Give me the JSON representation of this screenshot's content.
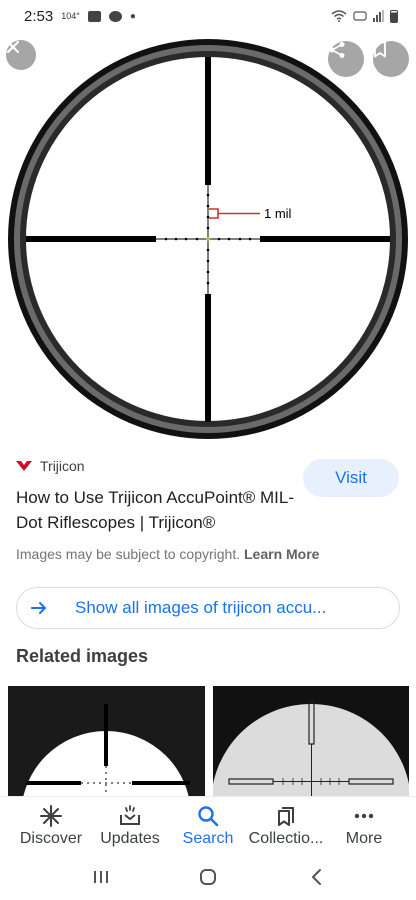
{
  "status_bar": {
    "time": "2:53",
    "temperature": "104°"
  },
  "viewer": {
    "image_annotation": "1 mil",
    "icons": {
      "close": "close-icon",
      "share": "share-icon",
      "save": "bookmark-icon"
    }
  },
  "result": {
    "source_name": "Trijicon",
    "visit_label": "Visit",
    "title": "How to Use Trijicon AccuPoint® MIL-Dot Riflescopes | Trijicon®",
    "copyright_text": "Images may be subject to copyright.",
    "learn_more": "Learn More"
  },
  "show_all": {
    "label": "Show all images of trijicon accu..."
  },
  "related": {
    "heading": "Related images"
  },
  "bottom_nav": {
    "items": [
      {
        "label": "Discover",
        "icon": "asterisk-icon"
      },
      {
        "label": "Updates",
        "icon": "updates-icon"
      },
      {
        "label": "Search",
        "icon": "search-icon"
      },
      {
        "label": "Collectio...",
        "icon": "collections-icon"
      },
      {
        "label": "More",
        "icon": "more-dots-icon"
      }
    ],
    "active_index": 2
  },
  "colors": {
    "accent": "#1a73e8",
    "visit_bg": "#e8f0fe",
    "brand_red": "#c8102e"
  }
}
